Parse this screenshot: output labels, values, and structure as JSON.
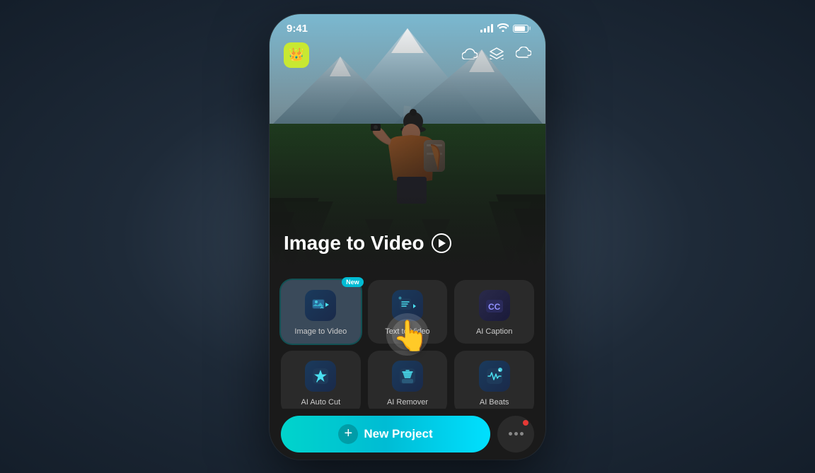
{
  "phone": {
    "statusBar": {
      "time": "9:41"
    },
    "header": {
      "crownIconLabel": "crown-icon",
      "headerIcons": [
        "cloud-icon",
        "mortarboard-icon",
        "cloud-icon-2"
      ]
    },
    "hero": {
      "title": "Image  to Video",
      "playButtonLabel": "play"
    },
    "featureBadge": "New",
    "features": [
      {
        "id": "image-to-video",
        "label": "Image to Video",
        "iconType": "img-video",
        "isNew": true,
        "isActive": true
      },
      {
        "id": "text-to-video",
        "label": "Text to Video",
        "iconType": "text-video",
        "isNew": false,
        "isActive": false
      },
      {
        "id": "ai-caption",
        "label": "AI Caption",
        "iconType": "cc",
        "isNew": false,
        "isActive": false
      },
      {
        "id": "ai-auto-cut",
        "label": "AI Auto Cut",
        "iconType": "lightning",
        "isNew": false,
        "isActive": false
      },
      {
        "id": "ai-remover",
        "label": "AI Remover",
        "iconType": "eraser",
        "isNew": false,
        "isActive": false
      },
      {
        "id": "ai-beats",
        "label": "AI Beats",
        "iconType": "music",
        "isNew": false,
        "isActive": false
      }
    ],
    "bottomBar": {
      "newProjectLabel": "New Project",
      "moreButtonLabel": "More"
    }
  }
}
